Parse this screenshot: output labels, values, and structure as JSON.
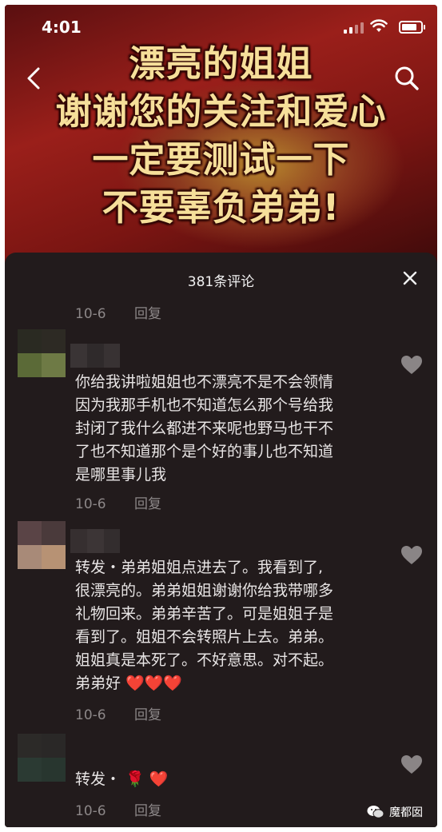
{
  "status_bar": {
    "time": "4:01"
  },
  "video": {
    "overlay_lines": [
      "漂亮的姐姐",
      "谢谢您的关注和爱心",
      "一定要测试一下",
      "不要辜负弟弟!"
    ]
  },
  "comments_sheet": {
    "title": "381条评论",
    "items": [
      {
        "date": "10-6",
        "reply": "回复"
      },
      {
        "text": "你给我讲啦姐姐也不漂亮不是不会领情因为我那手机也不知道怎么那个号给我封闭了我什么都进不来呢也野马也干不了也不知道那个是个好的事儿也不知道是哪里事儿我",
        "lines": [
          "你给我讲啦姐姐也不漂亮不是不会领情",
          "因为我那手机也不知道怎么那个号给我",
          "封闭了我什么都进不来呢也野马也干不",
          "了也不知道那个是个好的事儿也不知道",
          "是哪里事儿我"
        ],
        "date": "10-6",
        "reply": "回复"
      },
      {
        "lines": [
          "转发・弟弟姐姐点进去了。我看到了,",
          "很漂亮的。弟弟姐姐谢谢你给我带哪多",
          "礼物回来。弟弟辛苦了。可是姐姐子是",
          "看到了。姐姐不会转照片上去。弟弟。",
          "姐姐真是本死了。不好意思。对不起。",
          "弟弟好"
        ],
        "emoji": "❤️❤️❤️",
        "date": "10-6",
        "reply": "回复"
      },
      {
        "text": "转发・",
        "emoji": "🌹 ❤️",
        "date": "10-6",
        "reply": "回复"
      }
    ]
  },
  "watermark": {
    "text": "魔都囡"
  },
  "icons": [
    "back-arrow-icon",
    "search-icon",
    "close-icon",
    "heart-icon",
    "wechat-icon"
  ],
  "colors": {
    "sheet_bg": "#221b1c",
    "text": "#e8e5e5",
    "meta": "#8c8788",
    "banner_text": "#f6df9a",
    "heart_inactive": "#8a8586"
  }
}
